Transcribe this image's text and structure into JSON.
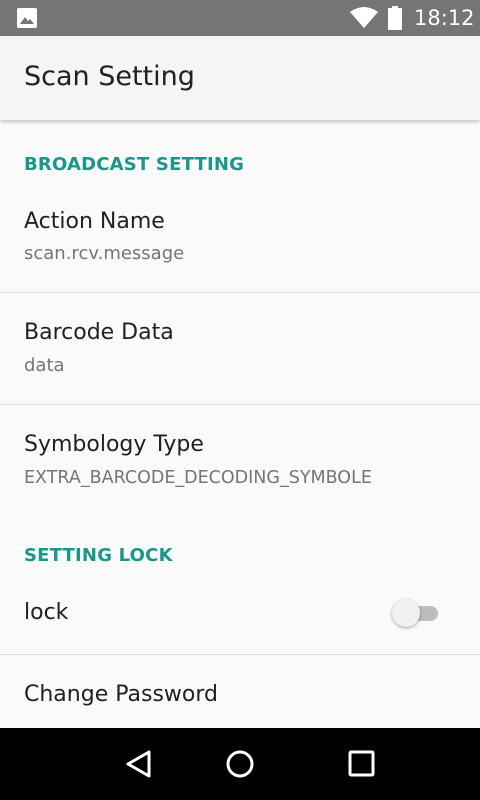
{
  "status_bar": {
    "time": "18:12",
    "icons": [
      "image-notification-icon",
      "wifi-icon",
      "battery-icon"
    ]
  },
  "app_bar": {
    "title": "Scan Setting"
  },
  "sections": {
    "broadcast": {
      "header": "BROADCAST SETTING",
      "items": [
        {
          "title": "Action Name",
          "summary": "scan.rcv.message"
        },
        {
          "title": "Barcode Data",
          "summary": "data"
        },
        {
          "title": "Symbology Type",
          "summary": "EXTRA_BARCODE_DECODING_SYMBOLE"
        }
      ]
    },
    "lock": {
      "header": "SETTING LOCK",
      "items": [
        {
          "title": "lock",
          "switch_on": false
        },
        {
          "title": "Change Password"
        }
      ]
    }
  },
  "nav_bar": {
    "icons": [
      "back-icon",
      "home-icon",
      "recents-icon"
    ]
  },
  "colors": {
    "accent": "#17988a",
    "status_bar": "#757575",
    "app_bar": "#f5f5f5",
    "background": "#fafafa",
    "nav_bar": "#000000"
  }
}
